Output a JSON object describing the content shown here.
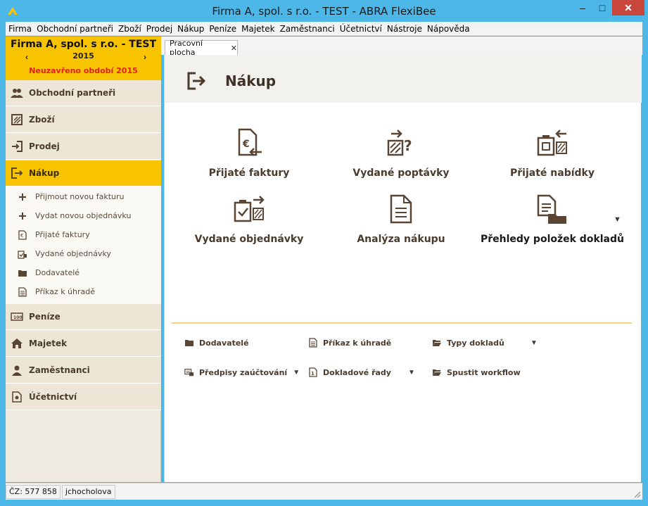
{
  "window": {
    "title": "Firma A, spol. s r.o. - TEST - ABRA FlexiBee",
    "minimize_glyph": "–",
    "maximize_glyph": "□",
    "close_glyph": "✕"
  },
  "menu": [
    "Firma",
    "Obchodní partneři",
    "Zboží",
    "Prodej",
    "Nákup",
    "Peníze",
    "Majetek",
    "Zaměstnanci",
    "Účetnictví",
    "Nástroje",
    "Nápověda"
  ],
  "company": {
    "name": "Firma A, spol. s r.o. - TEST",
    "year": "2015",
    "prev": "‹",
    "next": "›",
    "period": "Neuzavřeno období 2015"
  },
  "nav_top": [
    {
      "label": "Obchodní partneři",
      "icon": "partners-icon"
    },
    {
      "label": "Zboží",
      "icon": "goods-icon"
    },
    {
      "label": "Prodej",
      "icon": "sales-icon"
    },
    {
      "label": "Nákup",
      "icon": "purchase-icon",
      "active": true
    }
  ],
  "sub_items": [
    {
      "label": "Přijmout novou fakturu",
      "icon": "plus-icon"
    },
    {
      "label": "Vydat novou objednávku",
      "icon": "plus-icon"
    },
    {
      "label": "Přijaté faktury",
      "icon": "invoice-icon"
    },
    {
      "label": "Vydané objednávky",
      "icon": "order-icon"
    },
    {
      "label": "Dodavatelé",
      "icon": "folder-icon"
    },
    {
      "label": "Příkaz k úhradě",
      "icon": "document-icon"
    }
  ],
  "nav_bottom": [
    {
      "label": "Peníze",
      "icon": "money-icon"
    },
    {
      "label": "Majetek",
      "icon": "assets-icon"
    },
    {
      "label": "Zaměstnanci",
      "icon": "employee-icon"
    },
    {
      "label": "Účetnictví",
      "icon": "accounting-icon"
    }
  ],
  "tab": {
    "label": "Pracovní plocha",
    "close": "✕"
  },
  "page": {
    "title": "Nákup"
  },
  "tiles": [
    {
      "label": "Přijaté faktury",
      "icon": "received-invoice-icon"
    },
    {
      "label": "Vydané poptávky",
      "icon": "inquiry-icon"
    },
    {
      "label": "Přijaté nabídky",
      "icon": "offer-icon"
    },
    {
      "label": "Vydané objednávky",
      "icon": "issued-order-icon"
    },
    {
      "label": "Analýza nákupu",
      "icon": "analysis-icon"
    },
    {
      "label": "Přehledy položek dokladů",
      "icon": "document-folder-icon",
      "has_dropdown": true
    }
  ],
  "links": [
    {
      "label": "Dodavatelé",
      "icon": "folder-icon"
    },
    {
      "label": "Příkaz k úhradě",
      "icon": "document-icon"
    },
    {
      "label": "Typy dokladů",
      "icon": "folder-open-icon",
      "has_dropdown": true
    },
    {
      "label": "Předpisy zaúčtování",
      "icon": "posting-icon",
      "has_dropdown": true
    },
    {
      "label": "Dokladové řady",
      "icon": "series-icon",
      "has_dropdown": true
    },
    {
      "label": "Spustit workflow",
      "icon": "workflow-icon"
    }
  ],
  "status": {
    "currency": "ČZ: 577 858",
    "user": "jchocholova"
  },
  "colors": {
    "accent": "#f8c400",
    "title_bar": "#4db7e8",
    "icon_brown": "#5a4535",
    "alert": "#e02020"
  }
}
